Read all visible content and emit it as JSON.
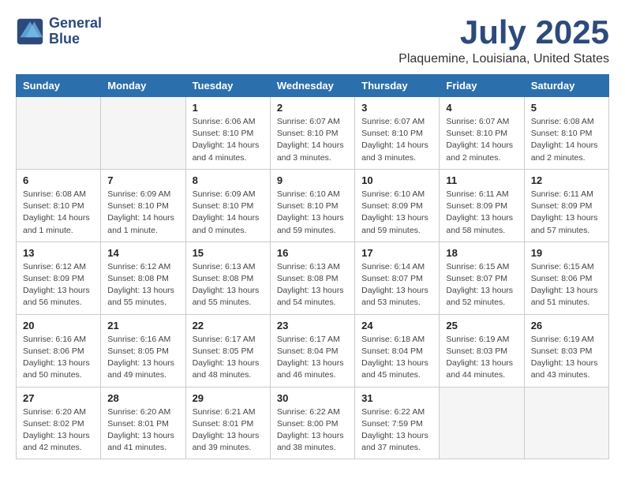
{
  "header": {
    "logo_line1": "General",
    "logo_line2": "Blue",
    "month": "July 2025",
    "location": "Plaquemine, Louisiana, United States"
  },
  "weekdays": [
    "Sunday",
    "Monday",
    "Tuesday",
    "Wednesday",
    "Thursday",
    "Friday",
    "Saturday"
  ],
  "weeks": [
    [
      {
        "day": "",
        "info": ""
      },
      {
        "day": "",
        "info": ""
      },
      {
        "day": "1",
        "info": "Sunrise: 6:06 AM\nSunset: 8:10 PM\nDaylight: 14 hours\nand 4 minutes."
      },
      {
        "day": "2",
        "info": "Sunrise: 6:07 AM\nSunset: 8:10 PM\nDaylight: 14 hours\nand 3 minutes."
      },
      {
        "day": "3",
        "info": "Sunrise: 6:07 AM\nSunset: 8:10 PM\nDaylight: 14 hours\nand 3 minutes."
      },
      {
        "day": "4",
        "info": "Sunrise: 6:07 AM\nSunset: 8:10 PM\nDaylight: 14 hours\nand 2 minutes."
      },
      {
        "day": "5",
        "info": "Sunrise: 6:08 AM\nSunset: 8:10 PM\nDaylight: 14 hours\nand 2 minutes."
      }
    ],
    [
      {
        "day": "6",
        "info": "Sunrise: 6:08 AM\nSunset: 8:10 PM\nDaylight: 14 hours\nand 1 minute."
      },
      {
        "day": "7",
        "info": "Sunrise: 6:09 AM\nSunset: 8:10 PM\nDaylight: 14 hours\nand 1 minute."
      },
      {
        "day": "8",
        "info": "Sunrise: 6:09 AM\nSunset: 8:10 PM\nDaylight: 14 hours\nand 0 minutes."
      },
      {
        "day": "9",
        "info": "Sunrise: 6:10 AM\nSunset: 8:10 PM\nDaylight: 13 hours\nand 59 minutes."
      },
      {
        "day": "10",
        "info": "Sunrise: 6:10 AM\nSunset: 8:09 PM\nDaylight: 13 hours\nand 59 minutes."
      },
      {
        "day": "11",
        "info": "Sunrise: 6:11 AM\nSunset: 8:09 PM\nDaylight: 13 hours\nand 58 minutes."
      },
      {
        "day": "12",
        "info": "Sunrise: 6:11 AM\nSunset: 8:09 PM\nDaylight: 13 hours\nand 57 minutes."
      }
    ],
    [
      {
        "day": "13",
        "info": "Sunrise: 6:12 AM\nSunset: 8:09 PM\nDaylight: 13 hours\nand 56 minutes."
      },
      {
        "day": "14",
        "info": "Sunrise: 6:12 AM\nSunset: 8:08 PM\nDaylight: 13 hours\nand 55 minutes."
      },
      {
        "day": "15",
        "info": "Sunrise: 6:13 AM\nSunset: 8:08 PM\nDaylight: 13 hours\nand 55 minutes."
      },
      {
        "day": "16",
        "info": "Sunrise: 6:13 AM\nSunset: 8:08 PM\nDaylight: 13 hours\nand 54 minutes."
      },
      {
        "day": "17",
        "info": "Sunrise: 6:14 AM\nSunset: 8:07 PM\nDaylight: 13 hours\nand 53 minutes."
      },
      {
        "day": "18",
        "info": "Sunrise: 6:15 AM\nSunset: 8:07 PM\nDaylight: 13 hours\nand 52 minutes."
      },
      {
        "day": "19",
        "info": "Sunrise: 6:15 AM\nSunset: 8:06 PM\nDaylight: 13 hours\nand 51 minutes."
      }
    ],
    [
      {
        "day": "20",
        "info": "Sunrise: 6:16 AM\nSunset: 8:06 PM\nDaylight: 13 hours\nand 50 minutes."
      },
      {
        "day": "21",
        "info": "Sunrise: 6:16 AM\nSunset: 8:05 PM\nDaylight: 13 hours\nand 49 minutes."
      },
      {
        "day": "22",
        "info": "Sunrise: 6:17 AM\nSunset: 8:05 PM\nDaylight: 13 hours\nand 48 minutes."
      },
      {
        "day": "23",
        "info": "Sunrise: 6:17 AM\nSunset: 8:04 PM\nDaylight: 13 hours\nand 46 minutes."
      },
      {
        "day": "24",
        "info": "Sunrise: 6:18 AM\nSunset: 8:04 PM\nDaylight: 13 hours\nand 45 minutes."
      },
      {
        "day": "25",
        "info": "Sunrise: 6:19 AM\nSunset: 8:03 PM\nDaylight: 13 hours\nand 44 minutes."
      },
      {
        "day": "26",
        "info": "Sunrise: 6:19 AM\nSunset: 8:03 PM\nDaylight: 13 hours\nand 43 minutes."
      }
    ],
    [
      {
        "day": "27",
        "info": "Sunrise: 6:20 AM\nSunset: 8:02 PM\nDaylight: 13 hours\nand 42 minutes."
      },
      {
        "day": "28",
        "info": "Sunrise: 6:20 AM\nSunset: 8:01 PM\nDaylight: 13 hours\nand 41 minutes."
      },
      {
        "day": "29",
        "info": "Sunrise: 6:21 AM\nSunset: 8:01 PM\nDaylight: 13 hours\nand 39 minutes."
      },
      {
        "day": "30",
        "info": "Sunrise: 6:22 AM\nSunset: 8:00 PM\nDaylight: 13 hours\nand 38 minutes."
      },
      {
        "day": "31",
        "info": "Sunrise: 6:22 AM\nSunset: 7:59 PM\nDaylight: 13 hours\nand 37 minutes."
      },
      {
        "day": "",
        "info": ""
      },
      {
        "day": "",
        "info": ""
      }
    ]
  ]
}
